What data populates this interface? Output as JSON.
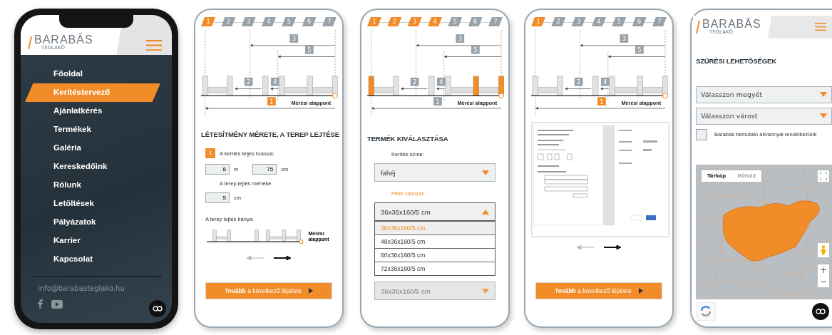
{
  "phones": [
    {
      "kind": "menu",
      "logo": {
        "name": "BARABĀS",
        "sub": "TÉGLAKŐ"
      },
      "menu": [
        {
          "label": "Főoldal",
          "selected": false
        },
        {
          "label": "Kerítéstervező",
          "selected": true
        },
        {
          "label": "Ajánlatkérés",
          "selected": false
        },
        {
          "label": "Termékek",
          "selected": false
        },
        {
          "label": "Galéria",
          "selected": false
        },
        {
          "label": "Kereskedőink",
          "selected": false
        },
        {
          "label": "Rólunk",
          "selected": false
        },
        {
          "label": "Letöltések",
          "selected": false
        },
        {
          "label": "Pályázatok",
          "selected": false
        },
        {
          "label": "Karrier",
          "selected": false
        },
        {
          "label": "Kapcsolat",
          "selected": false
        }
      ],
      "email": "info@barabasteglako.hu"
    },
    {
      "kind": "size",
      "steps": [
        {
          "label": "1",
          "done": true
        },
        {
          "label": "2",
          "done": false
        },
        {
          "label": "3",
          "done": false
        },
        {
          "label": "4",
          "done": false
        },
        {
          "label": "5",
          "done": false
        },
        {
          "label": "6",
          "done": false
        },
        {
          "label": "7",
          "done": false
        }
      ],
      "diagram": {
        "base_label": "Mérési alappont",
        "colored_posts": false,
        "dims": [
          {
            "label": "3",
            "highlight": false
          },
          {
            "label": "5",
            "highlight": false
          },
          {
            "label": "2",
            "highlight": false
          },
          {
            "label": "4",
            "highlight": false
          },
          {
            "label": "1",
            "highlight": true
          }
        ]
      },
      "heading": "LÉTESÍTMÉNY MÉRETE, A TEREP LEJTÉSE",
      "step_badge": "1",
      "length_label": "A kerítés teljes hossza:",
      "length_m": "8",
      "unit_m": "m",
      "length_cm": "75",
      "unit_cm": "cm",
      "slope_label": "A terep lejtés mértéke:",
      "slope": "5",
      "slope_unit": "cm",
      "direction_label": "A terep lejtés iránya:",
      "mini_label": "Mérési alappont",
      "directions": [
        {
          "selected": false
        },
        {
          "selected": true
        }
      ],
      "button": "**Tovább** a következő lépésre"
    },
    {
      "kind": "product",
      "steps": [
        {
          "label": "1",
          "done": true
        },
        {
          "label": "2",
          "done": true
        },
        {
          "label": "3",
          "done": true
        },
        {
          "label": "4",
          "done": true
        },
        {
          "label": "5",
          "done": false
        },
        {
          "label": "6",
          "done": false
        },
        {
          "label": "7",
          "done": false
        }
      ],
      "diagram": {
        "base_label": "Mérési alappont",
        "colored_posts": true,
        "dims": [
          {
            "label": "3",
            "highlight": false
          },
          {
            "label": "5",
            "highlight": false
          },
          {
            "label": "2",
            "highlight": false
          },
          {
            "label": "4",
            "highlight": false
          },
          {
            "label": "1",
            "highlight": false
          }
        ]
      },
      "heading": "TERMÉK KIVÁLASZTÁSA",
      "color_label": "Kerítés színe:",
      "color_value": "fahéj",
      "pillar_label": "Pillér változat:",
      "pillar_value": "36x36x160/5 cm",
      "pillar_open": true,
      "options": [
        {
          "label": "36x36x160/5 cm",
          "selected": true
        },
        {
          "label": "48x36x160/5 cm",
          "selected": false
        },
        {
          "label": "60x36x160/5 cm",
          "selected": false
        },
        {
          "label": "72x36x160/5 cm",
          "selected": false
        }
      ],
      "next_select": {
        "value": "36x36x160/5 cm",
        "disabled": true
      }
    },
    {
      "kind": "print",
      "steps": [
        {
          "label": "1",
          "done": true
        },
        {
          "label": "2",
          "done": false
        },
        {
          "label": "3",
          "done": false
        },
        {
          "label": "4",
          "done": false
        },
        {
          "label": "5",
          "done": false
        },
        {
          "label": "6",
          "done": false
        },
        {
          "label": "7",
          "done": false
        }
      ],
      "diagram": {
        "base_label": "Mérési alappont",
        "colored_posts": false,
        "dims": [
          {
            "label": "3",
            "highlight": false
          },
          {
            "label": "5",
            "highlight": false
          },
          {
            "label": "2",
            "highlight": false
          },
          {
            "label": "4",
            "highlight": false
          },
          {
            "label": "1",
            "highlight": true
          }
        ]
      },
      "directions": [
        {
          "selected": false
        },
        {
          "selected": true
        }
      ],
      "button": "**Tovább** a következő lépésre"
    },
    {
      "kind": "dealers",
      "logo": {
        "name": "BARABĀS",
        "sub": "TÉGLAKŐ"
      },
      "heading": "SZŰRÉSI LEHETŐSÉGEK",
      "selects": [
        "Válasszon megyét",
        "Válasszon várost"
      ],
      "checkbox": {
        "label": "Barabás bemutató állvánnyal rendelkezünk",
        "checked": false
      },
      "map_tabs": [
        {
          "label": "Térkép",
          "selected": true
        },
        {
          "label": "Műhold",
          "selected": false
        }
      ],
      "zoom": [
        "+",
        "−"
      ]
    }
  ]
}
